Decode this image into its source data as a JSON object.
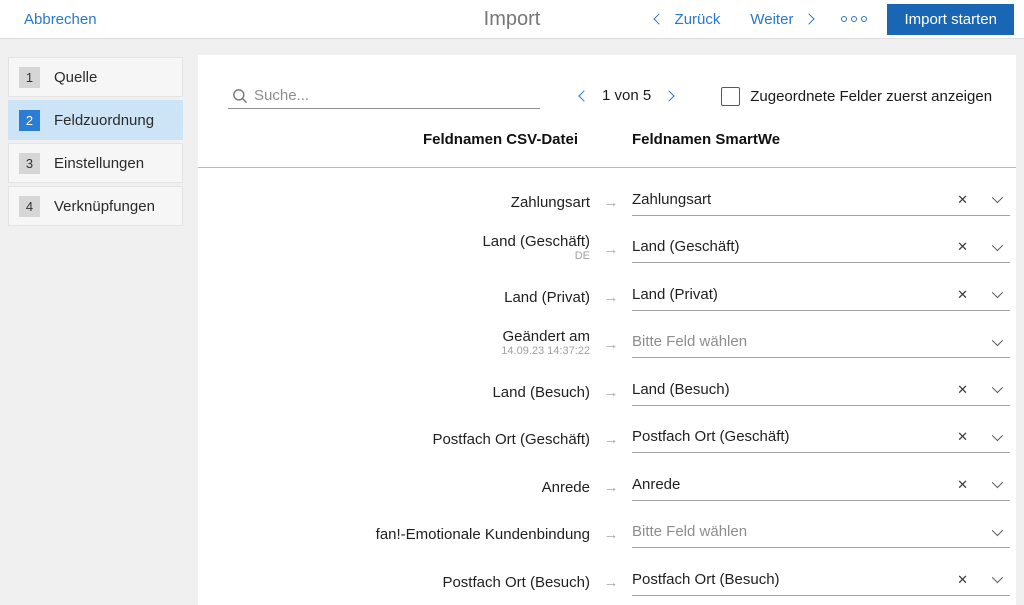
{
  "colors": {
    "link_blue": "#2779cb",
    "button_blue": "#1866b4",
    "selected_step_bg": "#cde4f7",
    "selected_badge_blue": "#2b7cd3"
  },
  "topbar": {
    "cancel": "Abbrechen",
    "title": "Import",
    "back": "Zurück",
    "next": "Weiter",
    "start": "Import starten"
  },
  "sidebar": {
    "steps": [
      {
        "num": "1",
        "label": "Quelle",
        "selected": false
      },
      {
        "num": "2",
        "label": "Feldzuordnung",
        "selected": true
      },
      {
        "num": "3",
        "label": "Einstellungen",
        "selected": false
      },
      {
        "num": "4",
        "label": "Verknüpfungen",
        "selected": false
      }
    ]
  },
  "toolbar": {
    "search_placeholder": "Suche...",
    "pagination": "1 von 5",
    "checkbox_label": "Zugeordnete Felder zuerst anzeigen",
    "checkbox_checked": false
  },
  "table": {
    "col_csv": "Feldnamen CSV-Datei",
    "col_target": "Feldnamen SmartWe",
    "placeholder": "Bitte Feld wählen",
    "rows": [
      {
        "csv": "Zahlungsart",
        "sub": "",
        "value": "Zahlungsart",
        "clearable": true
      },
      {
        "csv": "Land (Geschäft)",
        "sub": "DE",
        "value": "Land (Geschäft)",
        "clearable": true
      },
      {
        "csv": "Land (Privat)",
        "sub": "",
        "value": "Land (Privat)",
        "clearable": true
      },
      {
        "csv": "Geändert am",
        "sub": "14.09.23 14:37:22",
        "value": "",
        "clearable": false
      },
      {
        "csv": "Land (Besuch)",
        "sub": "",
        "value": "Land (Besuch)",
        "clearable": true
      },
      {
        "csv": "Postfach Ort (Geschäft)",
        "sub": "",
        "value": "Postfach Ort (Geschäft)",
        "clearable": true
      },
      {
        "csv": "Anrede",
        "sub": "",
        "value": "Anrede",
        "clearable": true
      },
      {
        "csv": "fan!-Emotionale Kundenbindung",
        "sub": "",
        "value": "",
        "clearable": false
      },
      {
        "csv": "Postfach Ort (Besuch)",
        "sub": "",
        "value": "Postfach Ort (Besuch)",
        "clearable": true
      }
    ]
  },
  "icons": {
    "arrow": "→",
    "clear": "✕"
  }
}
